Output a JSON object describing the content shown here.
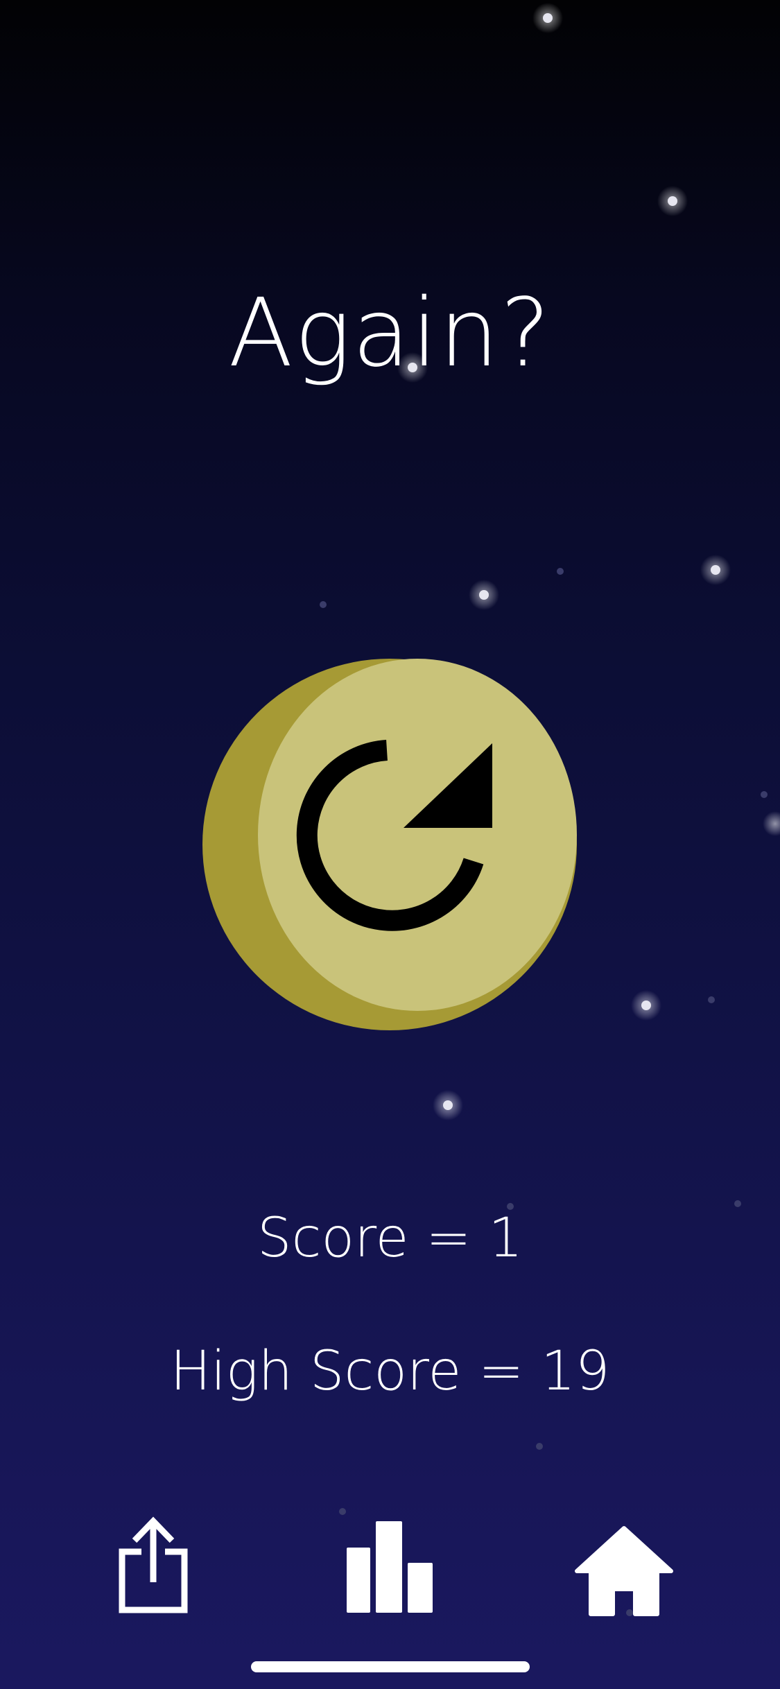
{
  "screen": {
    "title": "Again?",
    "score_text": "Score = 1",
    "high_score_text": "High Score = 19",
    "score": 1,
    "high_score": 19
  },
  "buttons": {
    "replay_icon": "replay-arrow-icon",
    "share_icon": "share-icon",
    "stats_icon": "bar-chart-icon",
    "home_icon": "home-icon"
  },
  "colors": {
    "sky_top": "#020204",
    "sky_bottom": "#1a185f",
    "moon_light": "#c9c37a",
    "moon_shadow": "#a69a35",
    "icon": "#ffffff"
  }
}
